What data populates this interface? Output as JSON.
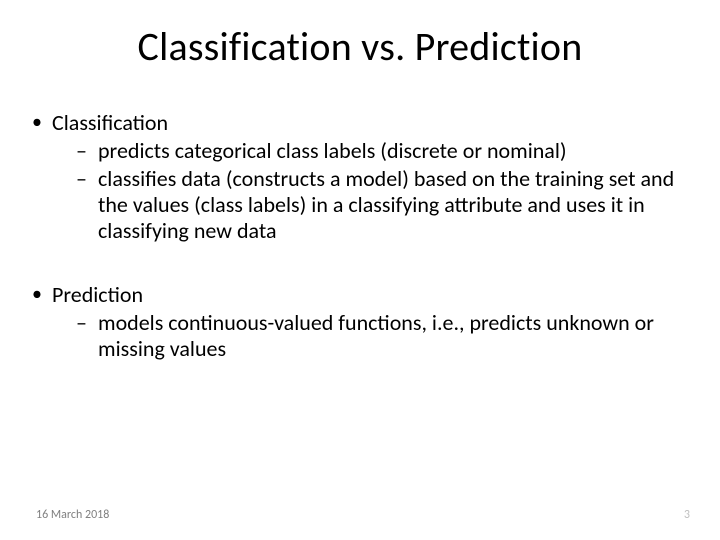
{
  "title": "Classification vs. Prediction",
  "bullets": [
    {
      "label": "Classification",
      "sub": [
        "predicts categorical class labels (discrete or nominal)",
        "classifies data (constructs a model) based on the training set and the values (class labels) in a classifying attribute and uses it in classifying new data"
      ]
    },
    {
      "label": "Prediction",
      "sub": [
        "models continuous-valued functions, i.e., predicts unknown or missing values"
      ]
    }
  ],
  "footer": {
    "date": "16 March 2018",
    "page": "3"
  }
}
